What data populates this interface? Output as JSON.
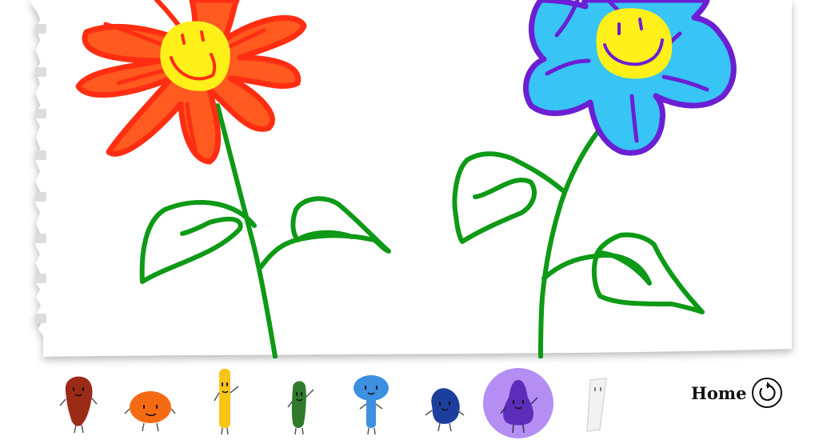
{
  "app": {
    "home_label": "Home",
    "selected_pen": "purple"
  },
  "pens": [
    {
      "id": "dark-red",
      "color": "#9b2a17"
    },
    {
      "id": "orange",
      "color": "#f46b14"
    },
    {
      "id": "yellow",
      "color": "#f8c516"
    },
    {
      "id": "green",
      "color": "#2f7a2c"
    },
    {
      "id": "light-blue",
      "color": "#3d8fe0"
    },
    {
      "id": "dark-blue",
      "color": "#1c3f9e"
    },
    {
      "id": "purple",
      "color": "#5b2db8"
    },
    {
      "id": "white",
      "color": "#f2f2f2"
    }
  ],
  "colors": {
    "selection_highlight": "#b48ef2",
    "drawing": {
      "red_outline": "#ff2e12",
      "red_fill": "#ff5a1f",
      "yellow": "#fff01a",
      "purple": "#6b1fd4",
      "light_blue": "#38c4f5",
      "green": "#0e9916"
    }
  },
  "icons": {
    "home": "refresh-icon"
  }
}
